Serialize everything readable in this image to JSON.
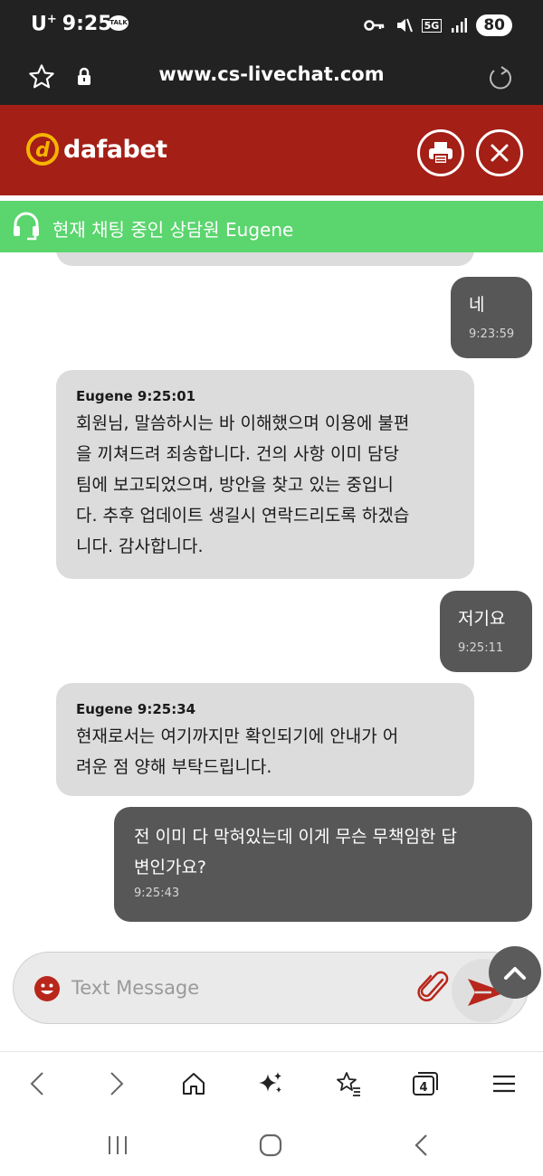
{
  "status_bar": {
    "carrier": "U",
    "carrier_sup": "+",
    "time": "9:25",
    "talk_badge": "TALK",
    "network": "5G",
    "battery": "80"
  },
  "browser": {
    "url": "www.cs-livechat.com",
    "tab_count": "4"
  },
  "header": {
    "brand_name": "dafabet",
    "brand_color": "#a41f16"
  },
  "agent_banner": {
    "text": "현재 채팅 중인 상담원 Eugene",
    "color": "#5bd56e"
  },
  "messages": [
    {
      "sender": "user",
      "text": "네",
      "time": "9:23:59"
    },
    {
      "sender": "agent",
      "header": "Eugene 9:25:01",
      "lines": [
        "회원님, 말씀하시는 바 이해했으며 이용에 불편",
        "을 끼쳐드려 죄송합니다. 건의 사항 이미 담당",
        "팀에 보고되었으며, 방안을 찾고 있는 중입니",
        "다. 추후 업데이트 생길시 연락드리도록 하겠습",
        "니다. 감사합니다."
      ]
    },
    {
      "sender": "user",
      "text": "저기요",
      "time": "9:25:11"
    },
    {
      "sender": "agent",
      "header": "Eugene 9:25:34",
      "lines": [
        "현재로서는 여기까지만 확인되기에 안내가 어",
        "려운 점 양해 부탁드립니다."
      ]
    },
    {
      "sender": "user",
      "lines": [
        "전 이미 다 막혀있는데 이게 무슨 무책임한 답",
        "변인가요?"
      ],
      "time": "9:25:43"
    }
  ],
  "input": {
    "placeholder": "Text Message"
  },
  "icons": {
    "star": "star-icon",
    "lock": "lock-icon",
    "reload": "reload-icon",
    "print": "printer-icon",
    "close": "close-icon",
    "headset": "headset-icon",
    "emoji": "emoji-icon",
    "attach": "paperclip-icon",
    "send": "send-icon"
  }
}
